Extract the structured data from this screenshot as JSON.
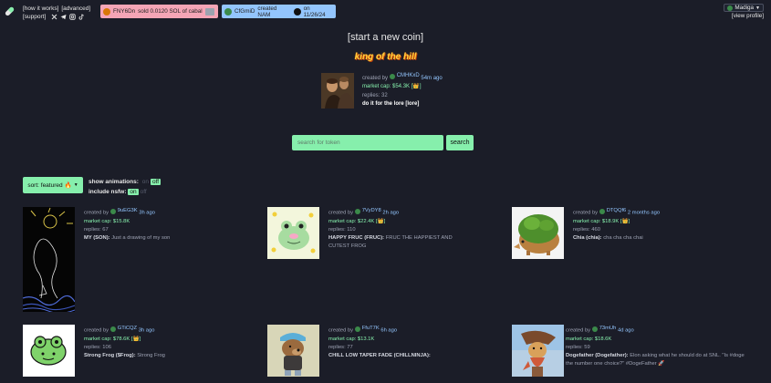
{
  "topnav": {
    "how_it_works": "[how it works]",
    "advanced": "[advanced]",
    "support": "[support]",
    "social_icons": [
      "x-icon",
      "telegram-icon",
      "instagram-icon",
      "tiktok-icon"
    ]
  },
  "ticker_sell": {
    "user": "FNY6Dn",
    "text": "sold 0.0120 SOL of cabal"
  },
  "ticker_create": {
    "user": "CfGmiD",
    "text": "created NAM",
    "date": "on 11/26/24"
  },
  "user_menu": {
    "name": "Madiga",
    "view_profile": "[view profile]"
  },
  "center": {
    "start_new_coin": "[start a new coin]",
    "king_of_the_hill": "king of the hill"
  },
  "koth": {
    "created_by_label": "created by",
    "creator": "CMHKxD",
    "age": "54m ago",
    "market_cap": "market cap: $54.3K",
    "replies": "replies: 32",
    "title": "do it for the lore [lore]"
  },
  "search": {
    "placeholder": "search for token",
    "button": "search"
  },
  "filters": {
    "sort_label": "sort: featured",
    "show_animations_label": "show animations:",
    "include_nsfw_label": "include nsfw:",
    "on": "on",
    "off": "off"
  },
  "cards": [
    {
      "creator": "9uEG3K",
      "age": "3h ago",
      "market_cap": "market cap: $15.8K",
      "replies": "replies: 67",
      "name": "MY (SON):",
      "desc": "Just a drawing of my son",
      "badge": false
    },
    {
      "creator": "7VyDY8",
      "age": "2h ago",
      "market_cap": "market cap: $22.4K",
      "replies": "replies: 110",
      "name": "HAPPY FRUC (FRUC):",
      "desc": "FRUC THE HAPPIEST AND CUTEST FROG",
      "badge": true
    },
    {
      "creator": "DTQQf6",
      "age": "2 months ago",
      "market_cap": "market cap: $18.9K",
      "replies": "replies: 460",
      "name": "Chia (chia):",
      "desc": "cha cha cha chai",
      "badge": true
    },
    {
      "creator": "GTiCQZ",
      "age": "3h ago",
      "market_cap": "market cap: $78.6K",
      "replies": "replies: 106",
      "name": "Strong Frog ($Frog):",
      "desc": "Strong Frog",
      "badge": true
    },
    {
      "creator": "FfuT7K",
      "age": "6h ago",
      "market_cap": "market cap: $13.1K",
      "replies": "replies: 77",
      "name": "CHILL LOW TAPER FADE (CHILLNINJA):",
      "desc": "",
      "badge": false
    },
    {
      "creator": "73mUh",
      "age": "4d ago",
      "market_cap": "market cap: $18.6K",
      "replies": "replies: 59",
      "name": "Dogefather (Dogefather):",
      "desc": "Elon asking what he should do at SNL. \"Is #doge the number one choice?\" #DogeFather 🚀",
      "badge": false
    }
  ],
  "colors": {
    "background": "#1b1d28",
    "accent_green": "#86efac",
    "ticker_sell": "#f5a5b6",
    "ticker_create": "#93c5fd"
  }
}
